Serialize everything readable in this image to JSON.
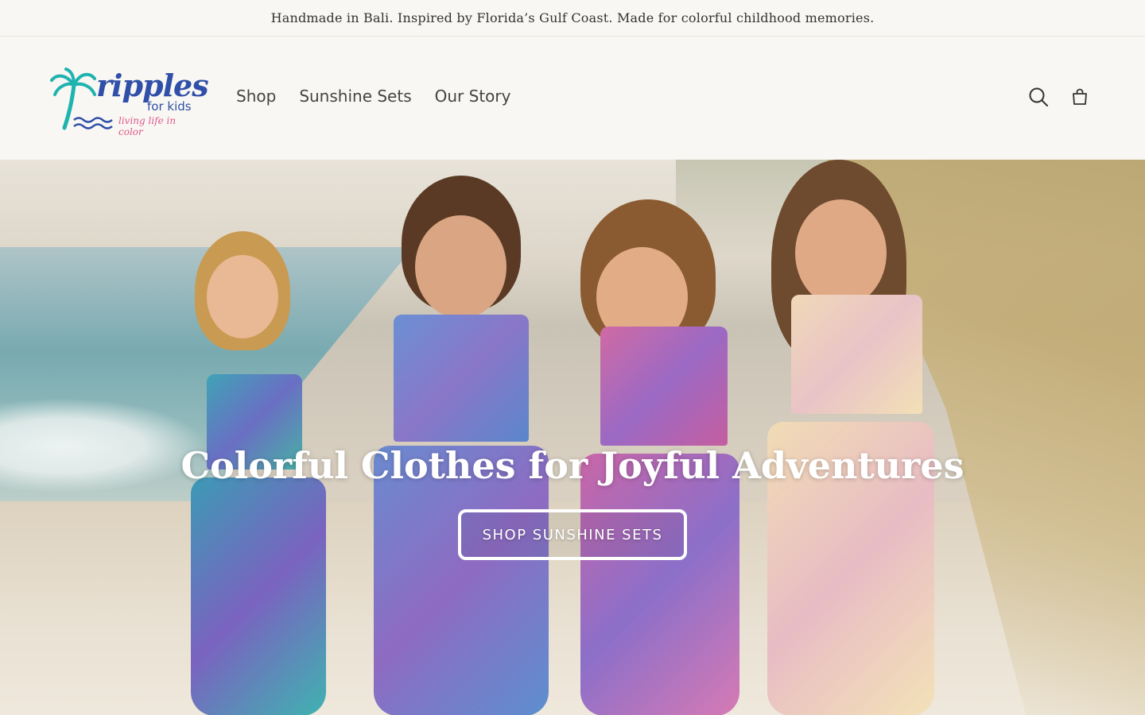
{
  "announcement": {
    "text": "Handmade in Bali. Inspired by Florida’s Gulf Coast. Made for colorful childhood memories."
  },
  "header": {
    "logo": {
      "word": "ripples",
      "sub": "for kids",
      "tagline": "living life in color"
    },
    "nav": [
      {
        "label": "Shop"
      },
      {
        "label": "Sunshine Sets"
      },
      {
        "label": "Our Story"
      }
    ],
    "icons": {
      "search": "search-icon",
      "cart": "cart-icon"
    }
  },
  "hero": {
    "title": "Colorful Clothes for Joyful Adventures",
    "button_label": "SHOP SUNSHINE SETS"
  },
  "colors": {
    "background": "#f8f7f3",
    "logo_blue": "#2f4fa8",
    "logo_teal": "#1fb3b0",
    "logo_pink": "#e0578d",
    "text": "#333333",
    "hero_text": "#ffffff"
  }
}
